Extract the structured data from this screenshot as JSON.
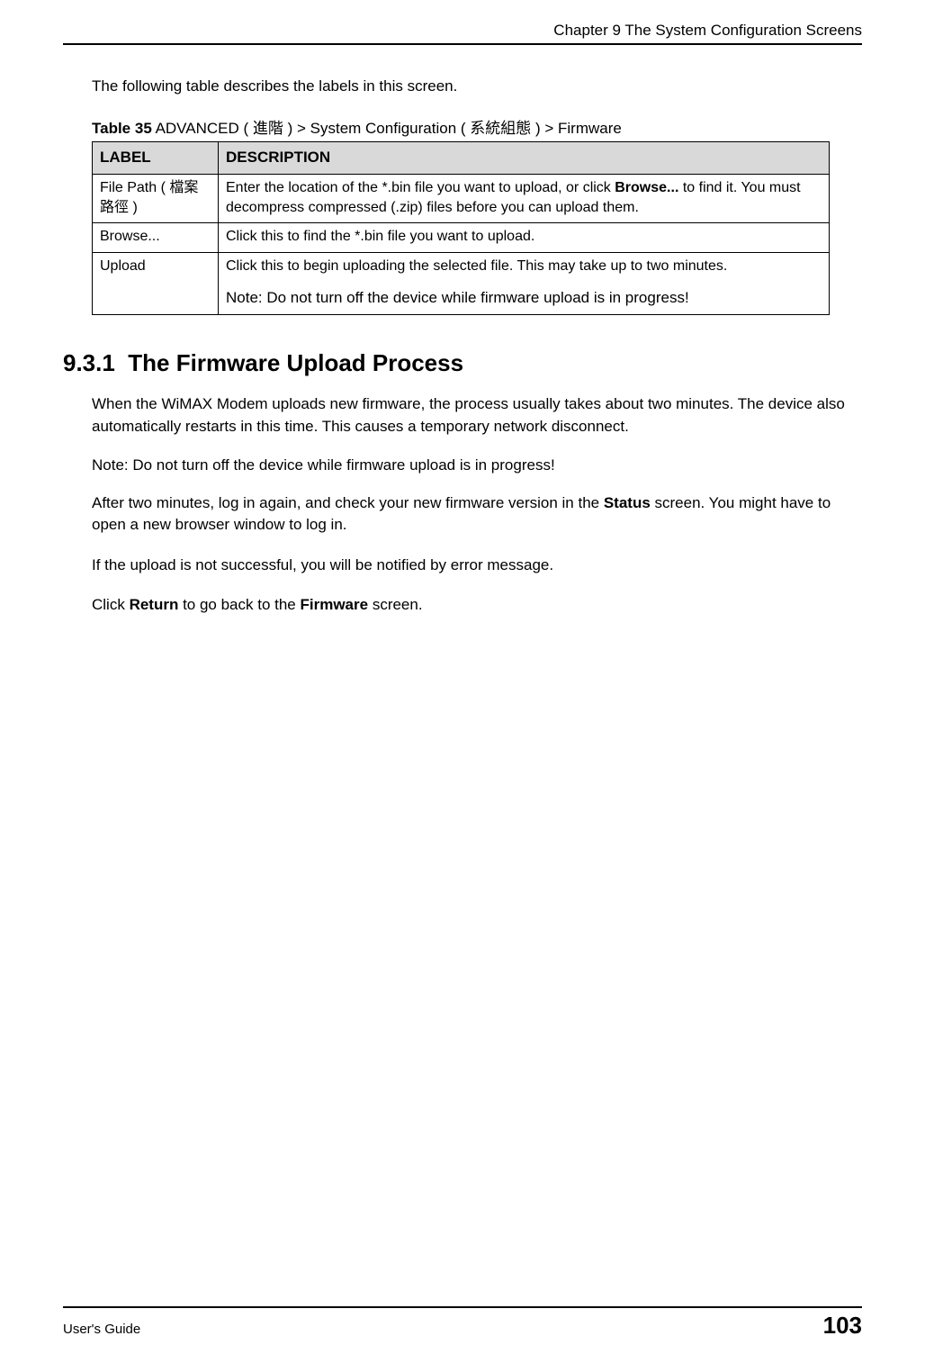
{
  "header": {
    "chapter": "Chapter 9 The System Configuration Screens"
  },
  "intro": "The following table describes the labels in this screen.",
  "table": {
    "caption_label": "Table 35",
    "caption_rest": "   ADVANCED ( 進階 ) > System Configuration ( 系統組態 ) > Firmware",
    "header_label": "LABEL",
    "header_desc": "DESCRIPTION",
    "rows": [
      {
        "label": "File Path ( 檔案路徑 )",
        "desc_pre": "Enter the location of the *.bin file you want to upload, or click ",
        "desc_bold": "Browse...",
        "desc_post": " to find it. You must decompress compressed (.zip) files before you can upload them."
      },
      {
        "label": "Browse...",
        "desc": "Click this to find the *.bin file you want to upload."
      },
      {
        "label": "Upload",
        "desc": "Click this to begin uploading the selected file. This may take up to two minutes.",
        "note": "Note: Do not turn off the device while firmware upload is in progress!"
      }
    ]
  },
  "section": {
    "number": "9.3.1",
    "title": "The Firmware Upload Process",
    "para1": "When the WiMAX Modem uploads new firmware, the process usually takes about two minutes. The device also automatically restarts in this time. This causes a temporary network disconnect.",
    "note": "Note: Do not turn off the device while firmware upload is in progress!",
    "para2_pre": "After two minutes, log in again, and check your new firmware version in the ",
    "para2_bold": "Status",
    "para2_post": " screen. You might have to open a new browser window to log in.",
    "para3": "If the upload is not successful, you will be notified by error message.",
    "para4_pre": "Click ",
    "para4_bold1": "Return",
    "para4_mid": " to go back to the ",
    "para4_bold2": "Firmware",
    "para4_post": " screen."
  },
  "footer": {
    "left": "User's Guide",
    "right": "103"
  }
}
